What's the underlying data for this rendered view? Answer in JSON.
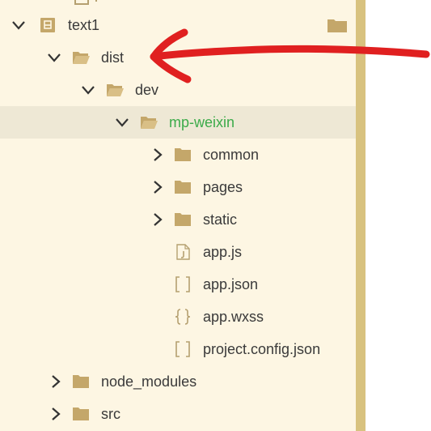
{
  "tree": {
    "nodes": [
      {
        "label": "text1",
        "icon": "project-icon",
        "expanded": true
      },
      {
        "label": "dist",
        "icon": "folder-open-icon",
        "expanded": true
      },
      {
        "label": "dev",
        "icon": "folder-open-icon",
        "expanded": true
      },
      {
        "label": "mp-weixin",
        "icon": "folder-open-icon",
        "expanded": true,
        "selected": true
      },
      {
        "label": "common",
        "icon": "folder-icon",
        "expanded": false
      },
      {
        "label": "pages",
        "icon": "folder-icon",
        "expanded": false
      },
      {
        "label": "static",
        "icon": "folder-icon",
        "expanded": false
      },
      {
        "label": "app.js",
        "icon": "js-file-icon"
      },
      {
        "label": "app.json",
        "icon": "json-file-icon"
      },
      {
        "label": "app.wxss",
        "icon": "wxss-file-icon"
      },
      {
        "label": "project.config.json",
        "icon": "json-file-icon"
      },
      {
        "label": "node_modules",
        "icon": "folder-icon",
        "expanded": false
      },
      {
        "label": "src",
        "icon": "folder-icon",
        "expanded": false
      }
    ]
  },
  "colors": {
    "tree_bg": "#fdf6e3",
    "selected_row_bg": "#eee8d5",
    "folder": "#c4a76a",
    "active_label": "#3cab4a",
    "divider": "#d8c27f",
    "annotation_arrow": "#e02020"
  }
}
